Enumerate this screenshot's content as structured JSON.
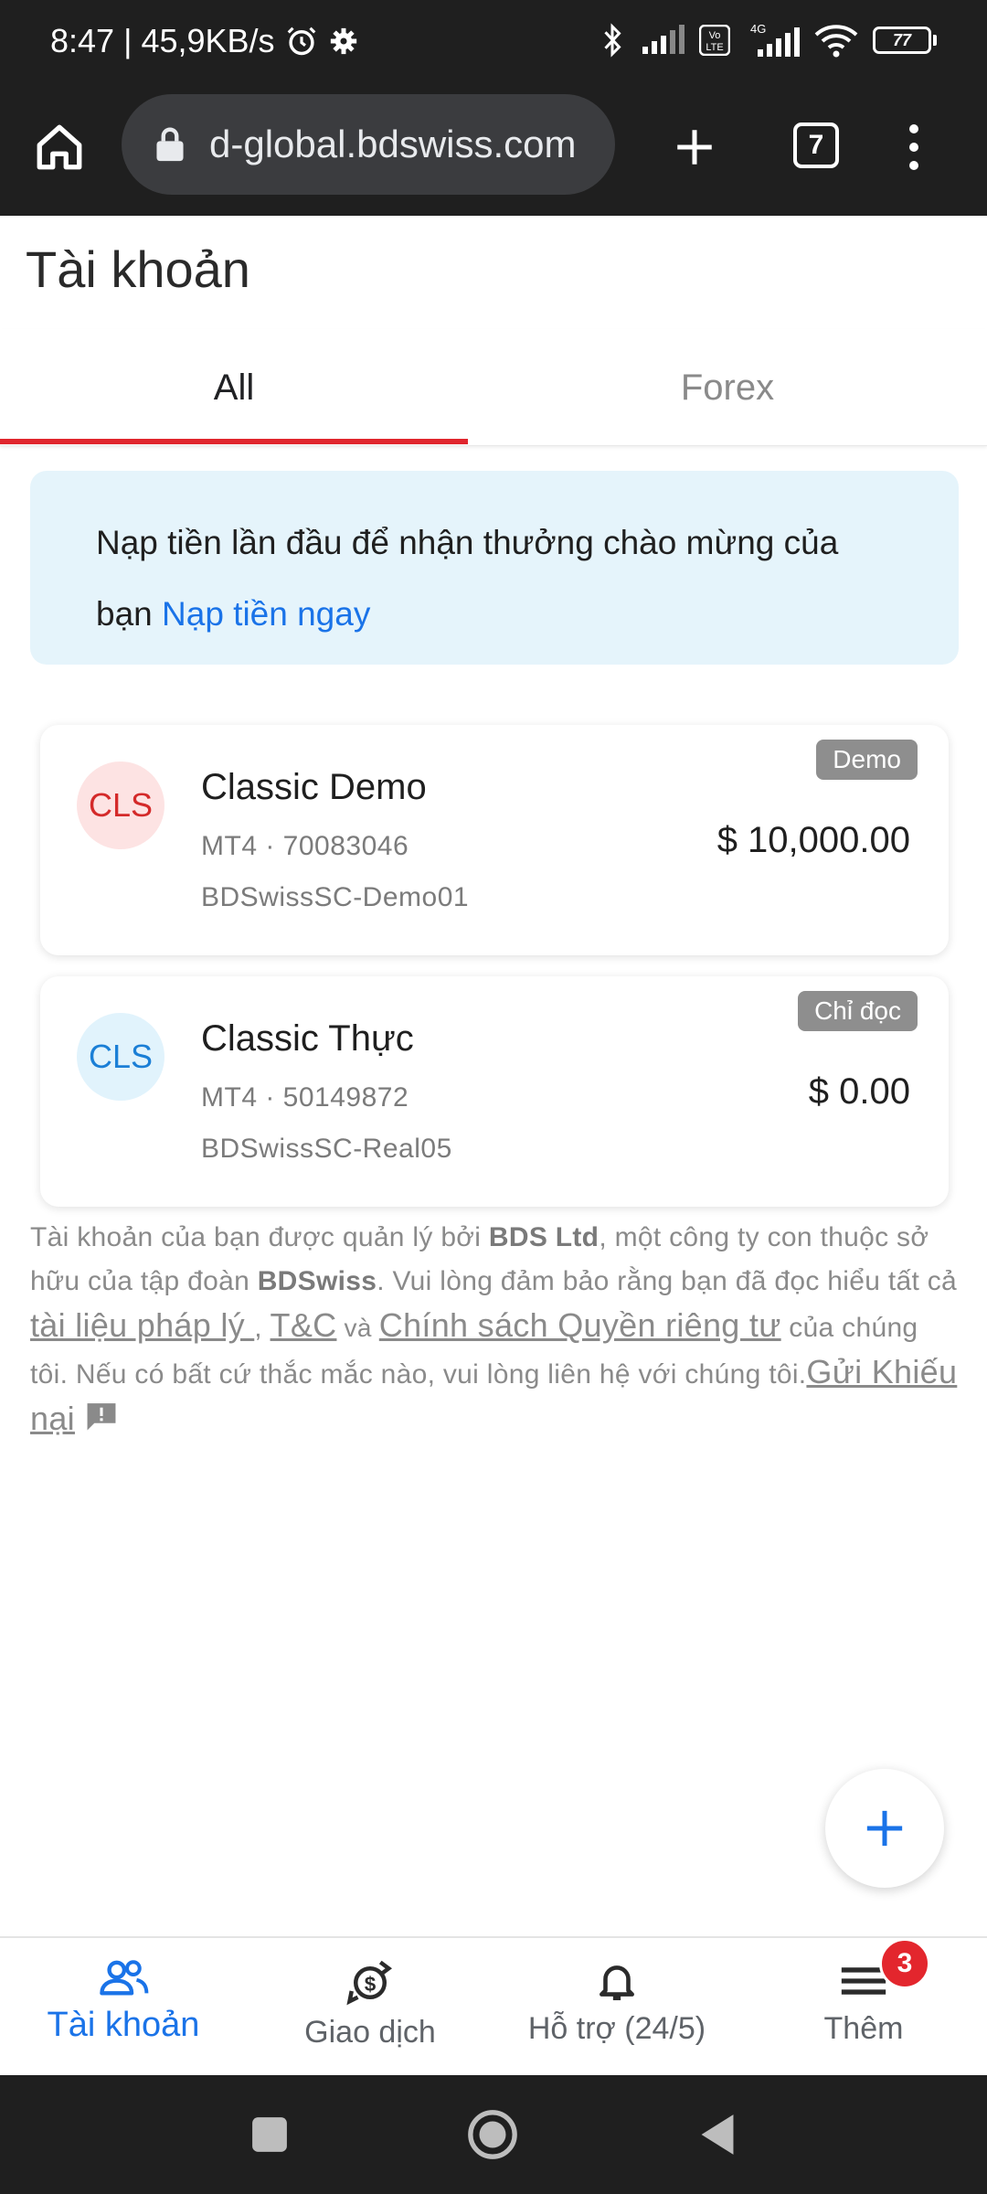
{
  "status_bar": {
    "time": "8:47",
    "separator": "|",
    "speed": "45,9KB/s",
    "network": "4G",
    "volte": "Vo LTE",
    "battery": "77"
  },
  "browser": {
    "url": "d-global.bdswiss.com",
    "tab_count": "7"
  },
  "page": {
    "title": "Tài khoản",
    "tabs": [
      {
        "label": "All",
        "active": true
      },
      {
        "label": "Forex",
        "active": false
      }
    ]
  },
  "promo": {
    "text": "Nạp tiền lần đầu để nhận thưởng chào mừng của bạn",
    "link": "Nạp tiền ngay"
  },
  "accounts": [
    {
      "avatar": "CLS",
      "name": "Classic Demo",
      "meta": "MT4 · 70083046",
      "server": "BDSwissSC-Demo01",
      "badge": "Demo",
      "balance": "$ 10,000.00"
    },
    {
      "avatar": "CLS",
      "name": "Classic Thực",
      "meta": "MT4 · 50149872",
      "server": "BDSwissSC-Real05",
      "badge": "Chỉ đọc",
      "balance": "$ 0.00"
    }
  ],
  "footer": {
    "p1": "Tài khoản của bạn được quản lý bởi ",
    "bds_ltd": "BDS Ltd",
    "p2": ", một công ty con thuộc sở hữu của tập đoàn ",
    "bdswiss": "BDSwiss",
    "p3": ". Vui lòng đảm bảo rằng bạn đã đọc hiểu tất cả ",
    "legal_link": "tài liệu pháp lý ",
    "comma": ", ",
    "tc_link": "T&C",
    "and": " và ",
    "privacy_link": "Chính sách Quyền riêng tư",
    "p4": " của chúng tôi. Nếu có bất cứ thắc mắc nào, vui lòng liên hệ với chúng tôi.",
    "complaint_link": "Gửi Khiếu nại"
  },
  "bottom_nav": [
    {
      "label": "Tài khoản",
      "icon": "people-icon",
      "active": true
    },
    {
      "label": "Giao dịch",
      "icon": "currency-exchange-icon",
      "active": false
    },
    {
      "label": "Hỗ trợ (24/5)",
      "icon": "bell-icon",
      "active": false
    },
    {
      "label": "Thêm",
      "icon": "menu-icon",
      "active": false,
      "badge": "3"
    }
  ],
  "colors": {
    "accent": "#1a73e8",
    "tab_indicator": "#e0262e",
    "promo_bg": "#e5f4fb",
    "badge_gray": "#8e8e8e",
    "notification_red": "#e3262d"
  }
}
